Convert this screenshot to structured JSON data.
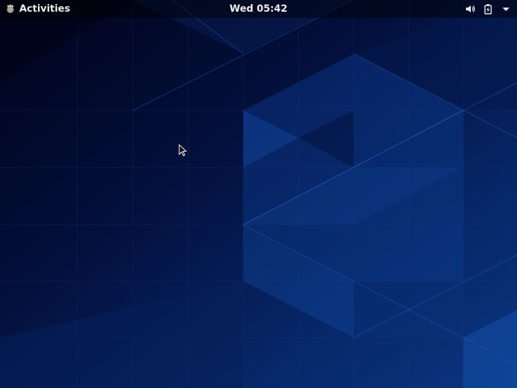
{
  "topbar": {
    "activities_label": "Activities",
    "clock": "Wed 05:42",
    "icons": {
      "activities": "gnome-foot-icon",
      "volume": "volume-icon",
      "battery": "battery-charging-icon",
      "menu": "chevron-down-icon"
    }
  },
  "colors": {
    "topbar_text": "#eeeeec",
    "wallpaper_dark": "#02051a",
    "wallpaper_accent": "#0d3a8a"
  }
}
